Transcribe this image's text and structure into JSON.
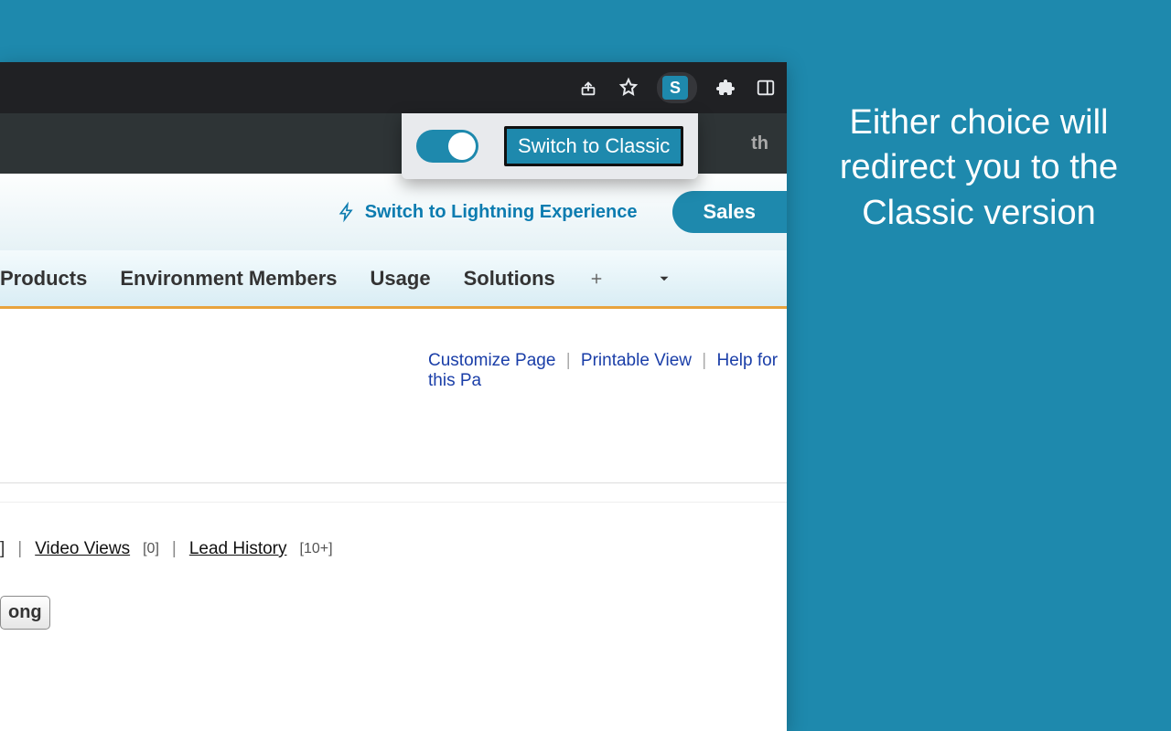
{
  "browser": {
    "ext_letter": "S"
  },
  "popup": {
    "button_label": "Switch to Classic"
  },
  "header": {
    "hint_text": "th"
  },
  "subheader": {
    "lightning_label": "Switch to Lightning Experience",
    "app_name": "Sales"
  },
  "nav": {
    "tabs": [
      "Products",
      "Environment Members",
      "Usage",
      "Solutions"
    ]
  },
  "page_links": {
    "customize": "Customize Page",
    "printable": "Printable View",
    "help": "Help for this Pa"
  },
  "related": {
    "fragment_close": "]",
    "video_views": "Video Views",
    "video_count": "[0]",
    "lead_history": "Lead History",
    "lead_count": "[10+]"
  },
  "button_fragment": "ong",
  "caption": "Either choice will redirect you to the Classic version"
}
